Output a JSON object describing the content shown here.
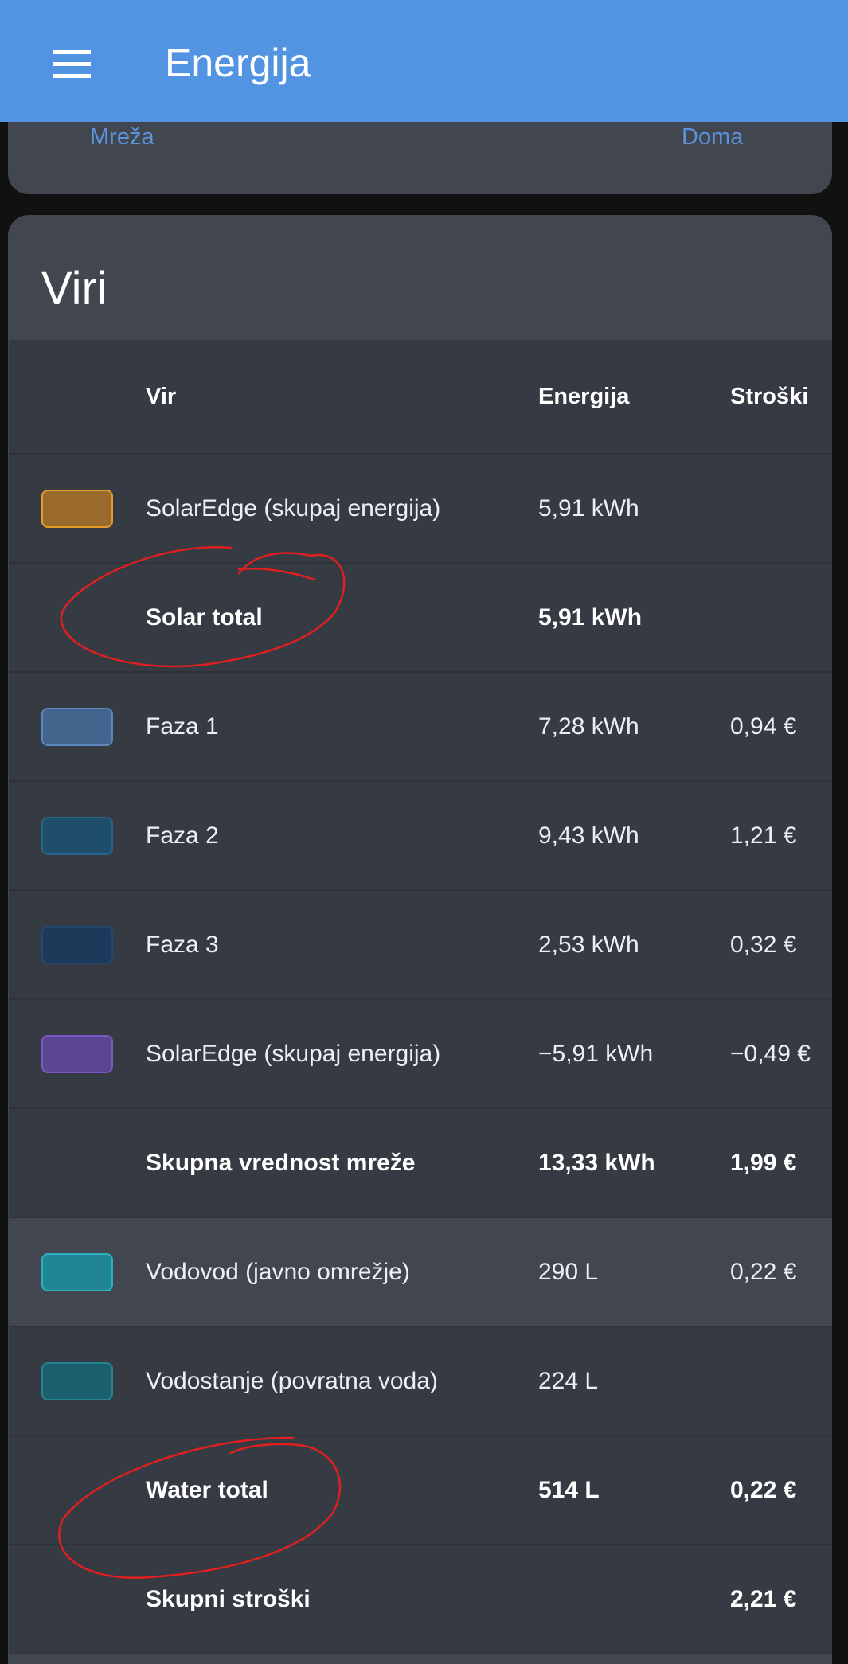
{
  "app": {
    "title": "Energija",
    "menu_icon": "menu-icon"
  },
  "top_card": {
    "left_link": "Mreža",
    "right_link": "Doma"
  },
  "sources": {
    "title": "Viri",
    "columns": {
      "source": "Vir",
      "energy": "Energija",
      "cost": "Stroški"
    },
    "rows": [
      {
        "name": "SolarEdge (skupaj energija)",
        "energy": "5,91 kWh",
        "cost": "",
        "swatch": "#9a6a2c",
        "border": "#e59a2a"
      },
      {
        "name": "Solar total",
        "energy": "5,91 kWh",
        "cost": ""
      },
      {
        "name": "Faza 1",
        "energy": "7,28 kWh",
        "cost": "0,94 €",
        "swatch": "#43658d",
        "border": "#5b87bd"
      },
      {
        "name": "Faza 2",
        "energy": "9,43 kWh",
        "cost": "1,21 €",
        "swatch": "#1f4e6b",
        "border": "#27648c"
      },
      {
        "name": "Faza 3",
        "energy": "2,53 kWh",
        "cost": "0,32 €",
        "swatch": "#1d3a5a",
        "border": "#214a73"
      },
      {
        "name": "SolarEdge (skupaj energija)",
        "energy": "−5,91 kWh",
        "cost": "−0,49 €",
        "swatch": "#5c4592",
        "border": "#7b59c3"
      },
      {
        "name": "Skupna vrednost mreže",
        "energy": "13,33 kWh",
        "cost": "1,99 €"
      },
      {
        "name": "Vodovod (javno omrežje)",
        "energy": "290 L",
        "cost": "0,22 €",
        "swatch": "#218694",
        "border": "#2bb0c1"
      },
      {
        "name": "Vodostanje (povratna voda)",
        "energy": "224 L",
        "cost": "",
        "swatch": "#1c5f6c",
        "border": "#268393"
      },
      {
        "name": "Water total",
        "energy": "514 L",
        "cost": "0,22 €"
      },
      {
        "name": "Skupni stroški",
        "energy": "",
        "cost": "2,21 €"
      }
    ]
  },
  "colors": {
    "appbar": "#5294e2",
    "card": "#41464f",
    "table": "#363a42",
    "link": "#5a93dc",
    "annotation": "#e02020"
  }
}
